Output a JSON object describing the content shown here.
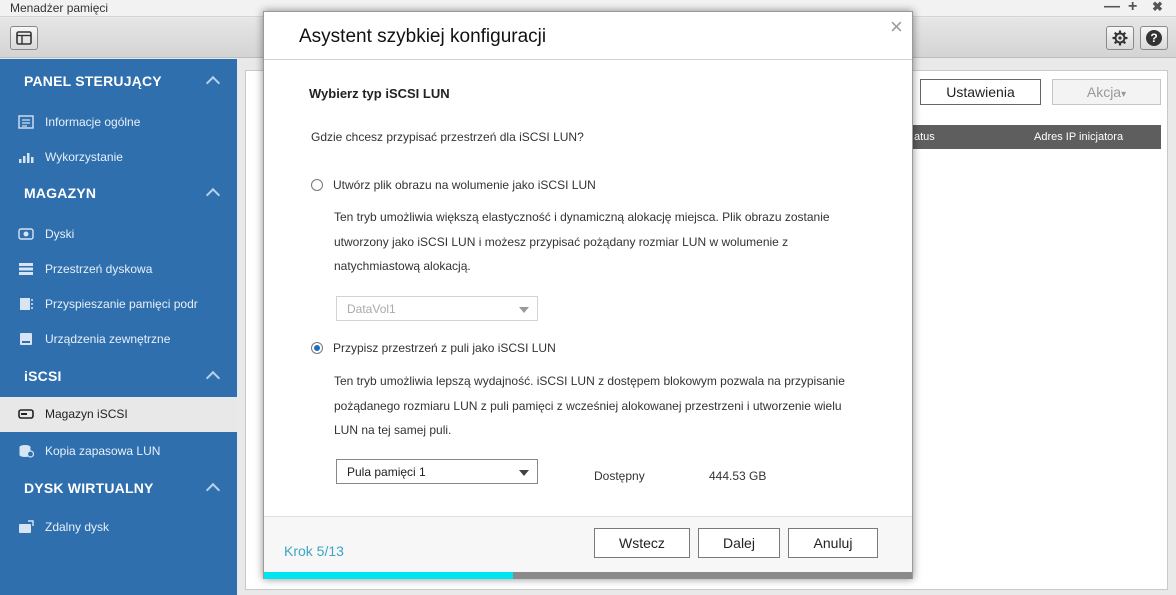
{
  "app": {
    "title": "Menadżer pamięci"
  },
  "window_controls": {
    "minimize": "—",
    "maximize": "+",
    "close": "✖"
  },
  "toolbar": {
    "home_icon": "window-layout-icon",
    "settings_icon": "gear-icon",
    "help_icon": "help-icon",
    "help_label": "?"
  },
  "sidebar": {
    "sections": [
      {
        "label": "PANEL STERUJĄCY",
        "items": [
          {
            "label": "Informacje ogólne",
            "icon": "info-icon"
          },
          {
            "label": "Wykorzystanie",
            "icon": "bar-chart-icon"
          }
        ]
      },
      {
        "label": "MAGAZYN",
        "items": [
          {
            "label": "Dyski",
            "icon": "disk-icon"
          },
          {
            "label": "Przestrzeń dyskowa",
            "icon": "storage-space-icon"
          },
          {
            "label": "Przyspieszanie pamięci podr",
            "icon": "cache-icon"
          },
          {
            "label": "Urządzenia zewnętrzne",
            "icon": "external-device-icon"
          }
        ]
      },
      {
        "label": "iSCSI",
        "items": [
          {
            "label": "Magazyn iSCSI",
            "icon": "iscsi-storage-icon",
            "active": true
          },
          {
            "label": "Kopia zapasowa LUN",
            "icon": "lun-backup-icon"
          }
        ]
      },
      {
        "label": "DYSK WIRTUALNY",
        "items": [
          {
            "label": "Zdalny dysk",
            "icon": "remote-disk-icon"
          }
        ]
      }
    ]
  },
  "main": {
    "settings_button": "Ustawienia",
    "action_button": "Akcja",
    "action_arrow": "▾",
    "table_headers": [
      "atus",
      "Adres IP inicjatora"
    ]
  },
  "dialog": {
    "title": "Asystent szybkiej konfiguracji",
    "close_glyph": "×",
    "subtitle": "Wybierz typ iSCSI LUN",
    "question": "Gdzie chcesz przypisać przestrzeń dla iSCSI LUN?",
    "option1": {
      "label": "Utwórz plik obrazu na wolumenie jako iSCSI LUN",
      "selected": false,
      "description": [
        "Ten tryb umożliwia większą elastyczność i dynamiczną alokację miejsca. Plik obrazu zostanie",
        "utworzony jako iSCSI LUN i możesz przypisać pożądany rozmiar LUN w wolumenie z",
        "natychmiastową alokacją."
      ],
      "select_value": "DataVol1",
      "select_disabled": true
    },
    "option2": {
      "label": "Przypisz przestrzeń z puli jako iSCSI LUN",
      "selected": true,
      "description": [
        "Ten tryb umożliwia lepszą wydajność. iSCSI LUN z dostępem blokowym pozwala na przypisanie",
        "pożądanego rozmiaru LUN z puli pamięci z wcześniej alokowanej przestrzeni i utworzenie wielu",
        "LUN na tej samej puli."
      ],
      "select_value": "Pula pamięci 1",
      "available_label": "Dostępny",
      "available_value": "444.53 GB"
    },
    "footer": {
      "step": "Krok 5/13",
      "back_button": "Wstecz",
      "next_button": "Dalej",
      "cancel_button": "Anuluj"
    },
    "progress": 0.385,
    "colors": {
      "accent": "#3aa5c5",
      "progress": "#00e5f0",
      "sidebar": "#2f6fae"
    }
  }
}
